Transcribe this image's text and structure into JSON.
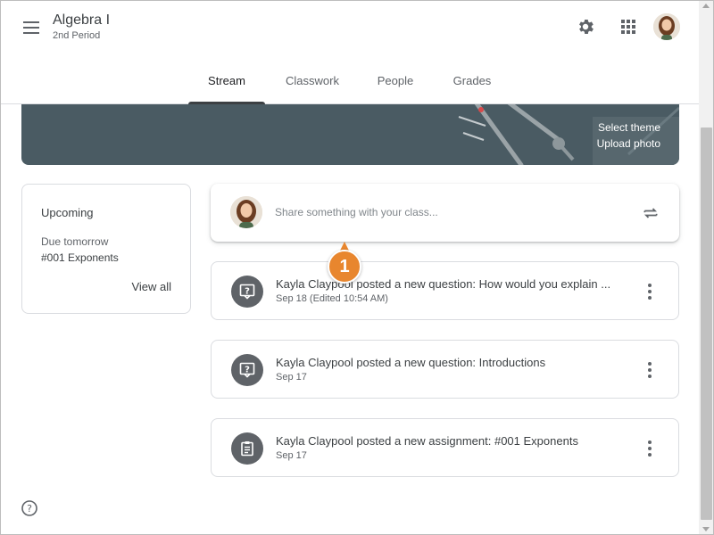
{
  "header": {
    "class_title": "Algebra I",
    "class_section": "2nd Period",
    "icons": {
      "menu": "menu-icon",
      "settings": "gear-icon",
      "apps": "apps-grid-icon",
      "avatar": "user-avatar"
    }
  },
  "tabs": [
    {
      "label": "Stream",
      "active": true
    },
    {
      "label": "Classwork",
      "active": false
    },
    {
      "label": "People",
      "active": false
    },
    {
      "label": "Grades",
      "active": false
    }
  ],
  "banner": {
    "select_theme": "Select theme",
    "upload_photo": "Upload photo",
    "color": "#4a5b63"
  },
  "upcoming": {
    "title": "Upcoming",
    "due_label": "Due tomorrow",
    "item": "#001 Exponents",
    "view_all": "View all"
  },
  "share": {
    "placeholder": "Share something with your class..."
  },
  "callout": {
    "number": "1",
    "color": "#e8862e"
  },
  "posts": [
    {
      "title": "Kayla Claypool posted a new question: How would you explain ...",
      "date": "Sep 18 (Edited 10:54 AM)",
      "icon": "question-icon"
    },
    {
      "title": "Kayla Claypool posted a new question: Introductions",
      "date": "Sep 17",
      "icon": "question-icon"
    },
    {
      "title": "Kayla Claypool posted a new assignment: #001 Exponents",
      "date": "Sep 17",
      "icon": "assignment-icon"
    }
  ],
  "colors": {
    "icon_gray": "#5f6368",
    "text": "#3c4043",
    "border": "#dadce0"
  }
}
